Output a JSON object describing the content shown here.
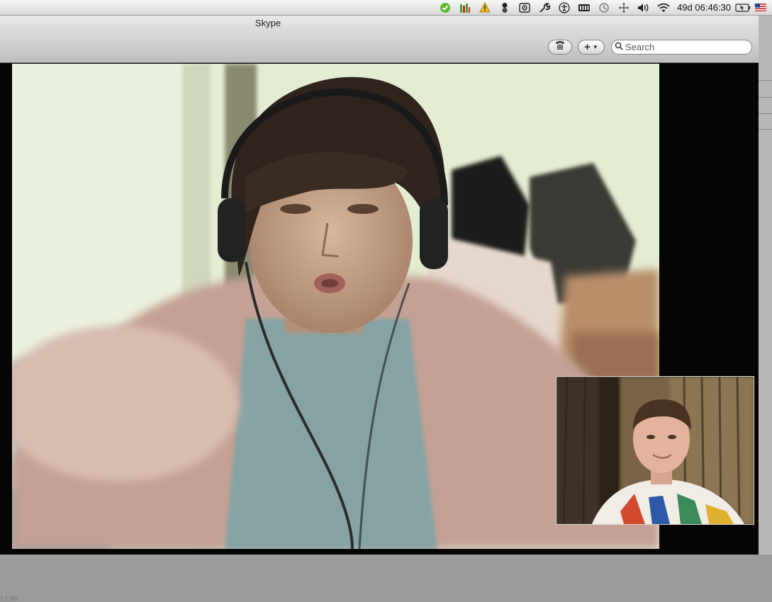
{
  "menubar": {
    "status_icons": [
      "skype-status-icon",
      "activity-monitor-icon",
      "warning-icon",
      "growl-icon",
      "airport-scan-icon",
      "tool-icon",
      "accessibility-icon",
      "battery-meter-icon",
      "time-machine-icon",
      "spaces-icon",
      "volume-icon",
      "wifi-icon"
    ],
    "clock": "49d 06:46:30",
    "extra_icons": [
      "battery-icon",
      "us-flag-icon"
    ]
  },
  "window": {
    "title": "Skype",
    "toolbar": {
      "dialpad_icon": "dialpad-icon",
      "add_label": "+",
      "add_menu_icon": "chevron-down-icon",
      "search_placeholder": "Search"
    }
  },
  "call": {
    "remote_video": "remote-participant-video",
    "self_video": "self-view-video"
  },
  "status": {
    "size_text": "1.5 MB"
  }
}
